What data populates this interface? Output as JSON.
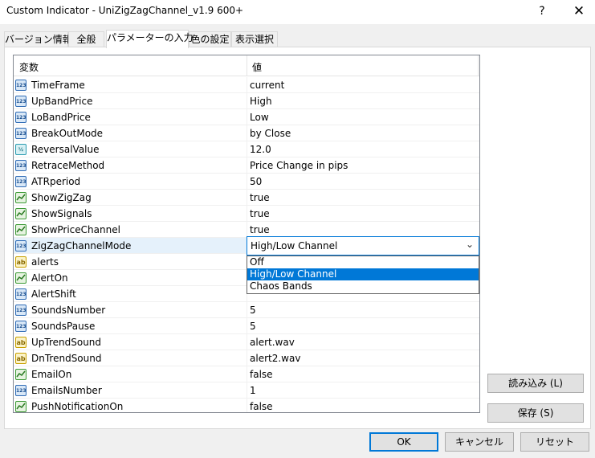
{
  "window": {
    "title": "Custom Indicator - UniZigZagChannel_v1.9 600+",
    "help_label": "?",
    "close_label": "✕"
  },
  "tabs": [
    {
      "label": "バージョン情報"
    },
    {
      "label": "全般"
    },
    {
      "label": "パラメーターの入力",
      "active": true
    },
    {
      "label": "色の設定"
    },
    {
      "label": "表示選択"
    }
  ],
  "grid": {
    "col_variable": "変数",
    "col_value": "値",
    "rows": [
      {
        "name": "TimeFrame",
        "value": "current",
        "type": "num"
      },
      {
        "name": "UpBandPrice",
        "value": "High",
        "type": "num"
      },
      {
        "name": "LoBandPrice",
        "value": "Low",
        "type": "num"
      },
      {
        "name": "BreakOutMode",
        "value": "by Close",
        "type": "num"
      },
      {
        "name": "ReversalValue",
        "value": "12.0",
        "type": "dbl"
      },
      {
        "name": "RetraceMethod",
        "value": "Price Change in pips",
        "type": "num"
      },
      {
        "name": "ATRperiod",
        "value": "50",
        "type": "num"
      },
      {
        "name": "ShowZigZag",
        "value": "true",
        "type": "bool"
      },
      {
        "name": "ShowSignals",
        "value": "true",
        "type": "bool"
      },
      {
        "name": "ShowPriceChannel",
        "value": "true",
        "type": "bool"
      },
      {
        "name": "ZigZagChannelMode",
        "value": "High/Low Channel",
        "type": "num"
      },
      {
        "name": "alerts",
        "value": "",
        "type": "str"
      },
      {
        "name": "AlertOn",
        "value": "",
        "type": "bool"
      },
      {
        "name": "AlertShift",
        "value": "",
        "type": "num"
      },
      {
        "name": "SoundsNumber",
        "value": "5",
        "type": "num"
      },
      {
        "name": "SoundsPause",
        "value": "5",
        "type": "num"
      },
      {
        "name": "UpTrendSound",
        "value": "alert.wav",
        "type": "str"
      },
      {
        "name": "DnTrendSound",
        "value": "alert2.wav",
        "type": "str"
      },
      {
        "name": "EmailOn",
        "value": "false",
        "type": "bool"
      },
      {
        "name": "EmailsNumber",
        "value": "1",
        "type": "num"
      },
      {
        "name": "PushNotificationOn",
        "value": "false",
        "type": "bool"
      }
    ],
    "icon_labels": {
      "num": "123",
      "dbl": "½",
      "str": "ab"
    },
    "combo_value": "High/Low Channel",
    "dropdown_options": [
      "Off",
      "High/Low Channel",
      "Chaos Bands"
    ],
    "dropdown_highlight_index": 1
  },
  "buttons": {
    "load": "読み込み (L)",
    "save": "保存 (S)",
    "ok": "OK",
    "cancel": "キャンセル",
    "reset": "リセット"
  },
  "colors": {
    "accent": "#0078d7",
    "selection_bg": "#e5f1fb"
  }
}
